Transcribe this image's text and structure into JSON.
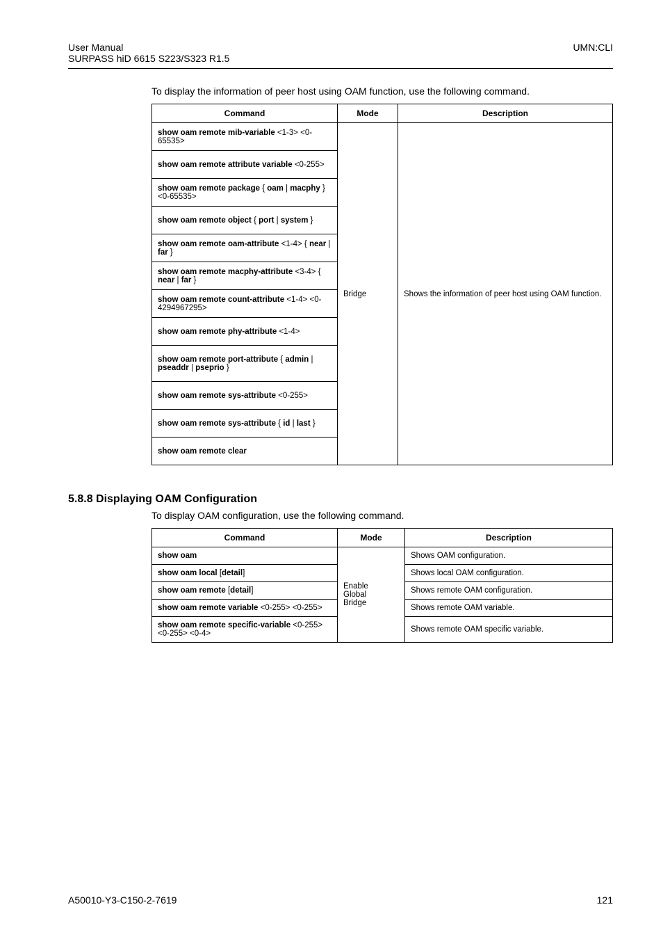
{
  "header": {
    "left_line1": "User  Manual",
    "left_line2": "SURPASS hiD 6615 S223/S323 R1.5",
    "right": "UMN:CLI"
  },
  "intro1": "To display the information of peer host using OAM function, use the following command.",
  "table1": {
    "h_command": "Command",
    "h_mode": "Mode",
    "h_desc": "Description",
    "mode": "Bridge",
    "desc": "Shows the information of peer host using OAM function.",
    "rows": [
      "show oam remote mib-variable <1-3> <0-65535>",
      "show oam remote attribute variable <0-255>",
      "show oam remote package { oam | macphy } <0-65535>",
      "show oam remote object { port | system }",
      "show oam remote oam-attribute <1-4> { near | far }",
      "show oam remote macphy-attribute <3-4> { near | far }",
      "show oam remote count-attribute <1-4> <0-4294967295>",
      "show oam remote phy-attribute <1-4>",
      "show oam remote port-attribute { admin | pseaddr | pseprio }",
      "show oam remote sys-attribute <0-255>",
      "show oam remote sys-attribute { id | last }",
      "show oam remote clear"
    ]
  },
  "section": "5.8.8  Displaying OAM Configuration",
  "intro2": "To display OAM configuration, use the following command.",
  "table2": {
    "h_command": "Command",
    "h_mode": "Mode",
    "h_desc": "Description",
    "mode": "Enable\nGlobal\nBridge",
    "rows": [
      {
        "cmd": "show oam",
        "desc": "Shows OAM configuration."
      },
      {
        "cmd": "show oam local [detail]",
        "desc": "Shows local OAM configuration."
      },
      {
        "cmd": "show oam remote [detail]",
        "desc": "Shows remote OAM configuration."
      },
      {
        "cmd": "show oam remote variable <0-255> <0-255>",
        "desc": "Shows remote OAM variable."
      },
      {
        "cmd": "show oam remote specific-variable <0-255> <0-255> <0-4>",
        "desc": "Shows remote OAM specific variable."
      }
    ]
  },
  "footer": {
    "left": "A50010-Y3-C150-2-7619",
    "right": "121"
  }
}
